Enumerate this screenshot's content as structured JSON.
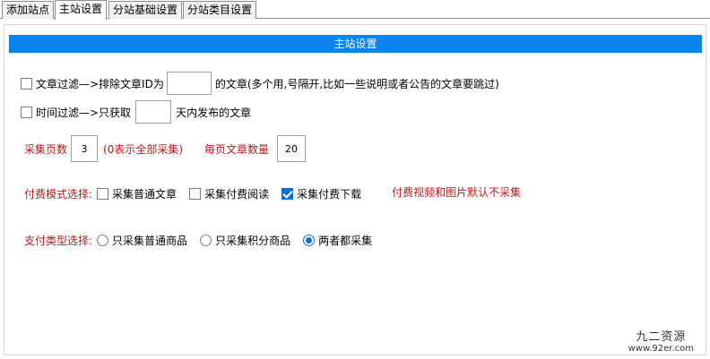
{
  "tabs": [
    {
      "label": "添加站点",
      "active": false
    },
    {
      "label": "主站设置",
      "active": true
    },
    {
      "label": "分站基础设置",
      "active": false
    },
    {
      "label": "分站类目设置",
      "active": false
    }
  ],
  "panel": {
    "title": "主站设置",
    "article_filter": {
      "checked": false,
      "prefix": "文章过滤—>排除文章ID为",
      "value": "",
      "suffix": "的文章(多个用,号隔开,比如一些说明或者公告的文章要跳过)"
    },
    "time_filter": {
      "checked": false,
      "prefix": "时间过滤—>只获取",
      "value": "",
      "suffix": "天内发布的文章"
    },
    "pages": {
      "label": "采集页数",
      "value": "3",
      "hint": "(0表示全部采集)",
      "per_page_label": "每页文章数量",
      "per_page_value": "20"
    },
    "paid_mode": {
      "label": "付费模式选择:",
      "options": [
        {
          "label": "采集普通文章",
          "checked": false
        },
        {
          "label": "采集付费阅读",
          "checked": false
        },
        {
          "label": "采集付费下载",
          "checked": true
        }
      ],
      "note": "付费视频和图片默认不采集"
    },
    "pay_type": {
      "label": "支付类型选择:",
      "options": [
        {
          "label": "只采集普通商品",
          "checked": false
        },
        {
          "label": "只采集积分商品",
          "checked": false
        },
        {
          "label": "两者都采集",
          "checked": true
        }
      ]
    }
  },
  "watermark": {
    "line1": "九二资源",
    "line2": "www.92er.com"
  },
  "colors": {
    "header_blue": "#0a83f0",
    "label_red": "#c0151b",
    "check_blue": "#0a6fd8"
  }
}
